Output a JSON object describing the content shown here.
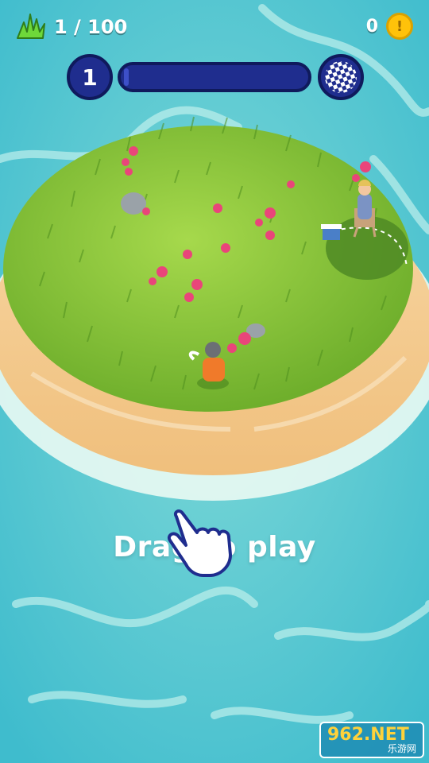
{
  "hud": {
    "grass_count": "1 / 100",
    "coins": "0",
    "coin_symbol": "!",
    "level": "1",
    "progress": 0.0
  },
  "prompt": {
    "drag_text": "Drag to play"
  },
  "watermark": {
    "top_text": "962.NET",
    "bottom_text": "乐游网"
  },
  "icons": {
    "grass": "grass-icon",
    "coin": "coin-icon",
    "finish": "checkered-flag-icon",
    "hand": "pointing-hand-icon"
  },
  "colors": {
    "water": "#5cc9d6",
    "sand": "#f2c48a",
    "grass": "#7fc03a",
    "hud_blue": "#1f2d8e",
    "coin": "#ffc20a"
  }
}
